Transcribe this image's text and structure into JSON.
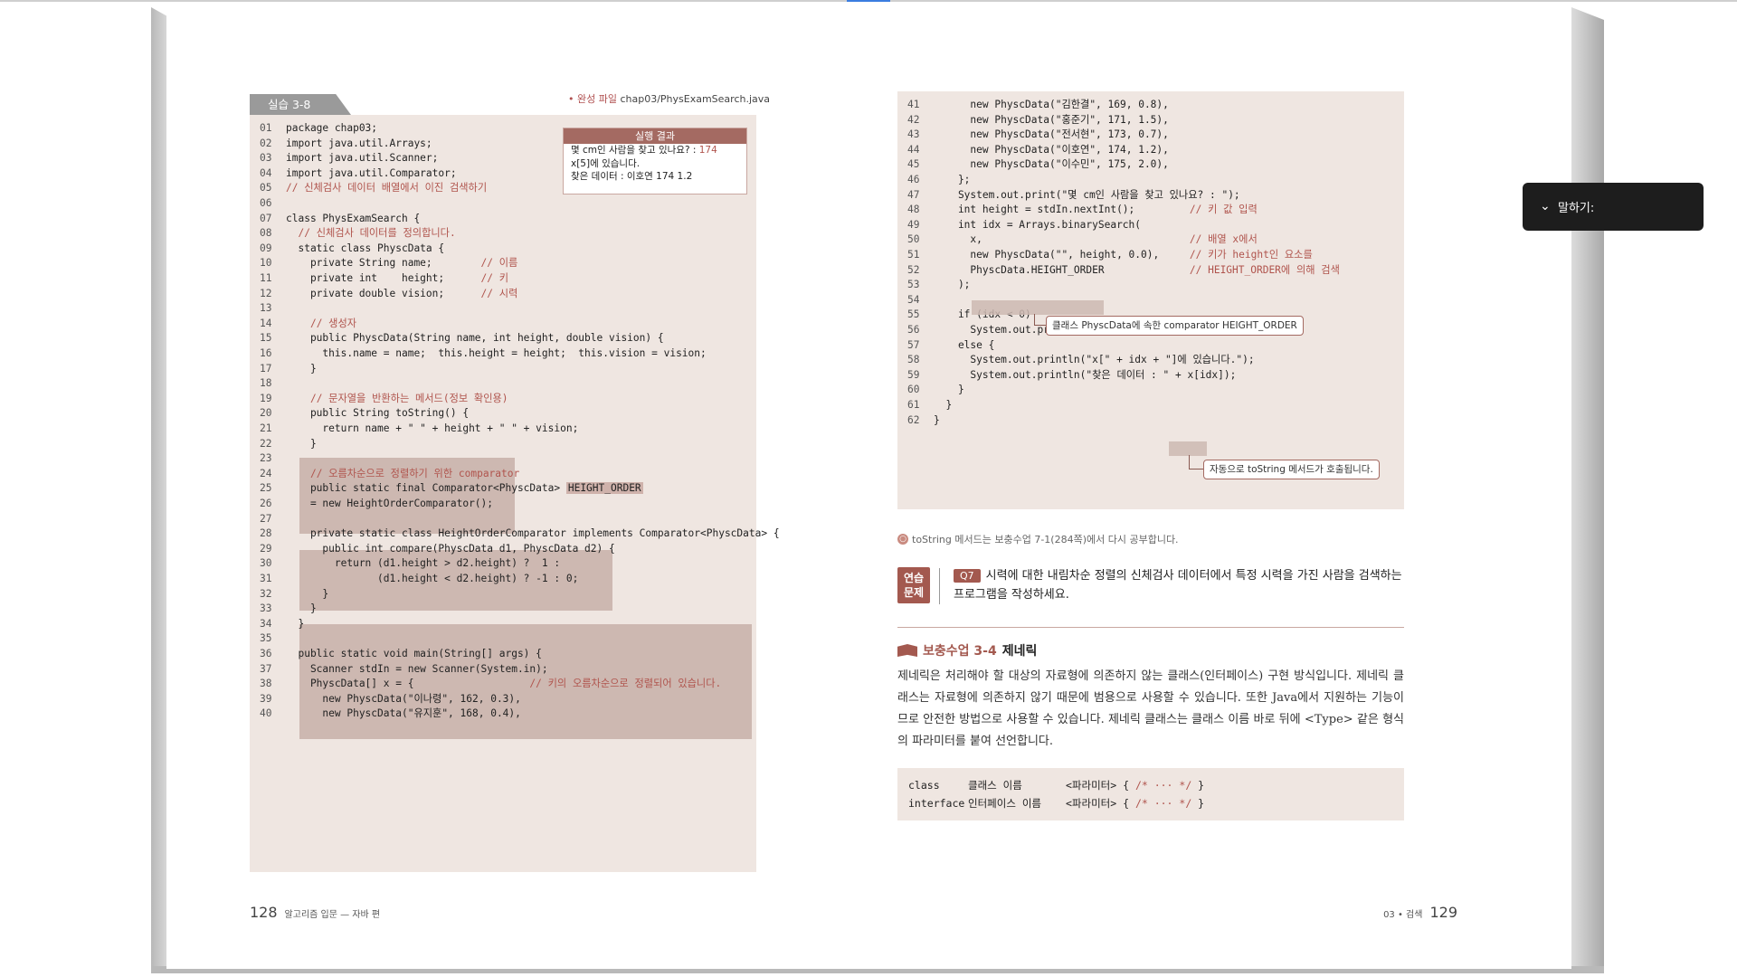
{
  "left_page": {
    "exercise_tag": "실습 3-8",
    "file_label_prefix": "• 완성 파일",
    "file_label_path": "chap03/PhysExamSearch.java",
    "result_box": {
      "title": "실행 결과",
      "lines": [
        "몇 cm인 사람을 찾고 있나요? : ",
        "x[5]에 있습니다.",
        "찾은 데이터 : 이호연 174 1.2"
      ],
      "input_value": "174"
    },
    "code_lines": [
      {
        "n": "01",
        "code": "package chap03;",
        "comment": ""
      },
      {
        "n": "02",
        "code": "import java.util.Arrays;",
        "comment": ""
      },
      {
        "n": "03",
        "code": "import java.util.Scanner;",
        "comment": ""
      },
      {
        "n": "04",
        "code": "import java.util.Comparator;",
        "comment": ""
      },
      {
        "n": "05",
        "code": "",
        "comment": "// 신체검사 데이터 배열에서 이진 검색하기"
      },
      {
        "n": "06",
        "code": "",
        "comment": ""
      },
      {
        "n": "07",
        "code": "class PhysExamSearch {",
        "comment": ""
      },
      {
        "n": "08",
        "code": "  ",
        "comment": "// 신체검사 데이터를 정의합니다."
      },
      {
        "n": "09",
        "code": "  static class PhyscData {",
        "comment": ""
      },
      {
        "n": "10",
        "code": "    private String name;        ",
        "comment": "// 이름"
      },
      {
        "n": "11",
        "code": "    private int    height;      ",
        "comment": "// 키"
      },
      {
        "n": "12",
        "code": "    private double vision;      ",
        "comment": "// 시력"
      },
      {
        "n": "13",
        "code": "",
        "comment": ""
      },
      {
        "n": "14",
        "code": "    ",
        "comment": "// 생성자"
      },
      {
        "n": "15",
        "code": "    public PhyscData(String name, int height, double vision) {",
        "comment": ""
      },
      {
        "n": "16",
        "code": "      this.name = name;  this.height = height;  this.vision = vision;",
        "comment": ""
      },
      {
        "n": "17",
        "code": "    }",
        "comment": ""
      },
      {
        "n": "18",
        "code": "",
        "comment": ""
      },
      {
        "n": "19",
        "code": "    ",
        "comment": "// 문자열을 반환하는 메서드(정보 확인용)"
      },
      {
        "n": "20",
        "code": "    public String toString() {",
        "comment": ""
      },
      {
        "n": "21",
        "code": "      return name + \" \" + height + \" \" + vision;",
        "comment": ""
      },
      {
        "n": "22",
        "code": "    }",
        "comment": ""
      },
      {
        "n": "23",
        "code": "",
        "comment": ""
      },
      {
        "n": "24",
        "code": "    ",
        "comment": "// 오름차순으로 정렬하기 위한 comparator"
      },
      {
        "n": "25",
        "code": "    public static final Comparator<PhyscData> ",
        "comment": "",
        "kw": "HEIGHT_ORDER"
      },
      {
        "n": "26",
        "code": "    = new HeightOrderComparator();",
        "comment": ""
      },
      {
        "n": "27",
        "code": "",
        "comment": ""
      },
      {
        "n": "28",
        "code": "    private static class HeightOrderComparator implements Comparator<PhyscData> {",
        "comment": ""
      },
      {
        "n": "29",
        "code": "      public int compare(PhyscData d1, PhyscData d2) {",
        "comment": ""
      },
      {
        "n": "30",
        "code": "        return (d1.height > d2.height) ?  1 :",
        "comment": ""
      },
      {
        "n": "31",
        "code": "               (d1.height < d2.height) ? -1 : 0;",
        "comment": ""
      },
      {
        "n": "32",
        "code": "      }",
        "comment": ""
      },
      {
        "n": "33",
        "code": "    }",
        "comment": ""
      },
      {
        "n": "34",
        "code": "  }",
        "comment": ""
      },
      {
        "n": "35",
        "code": "",
        "comment": ""
      },
      {
        "n": "36",
        "code": "  public static void main(String[] args) {",
        "comment": ""
      },
      {
        "n": "37",
        "code": "    Scanner stdIn = new Scanner(System.in);",
        "comment": ""
      },
      {
        "n": "38",
        "code": "    PhyscData[] x = {                   ",
        "comment": "// 키의 오름차순으로 정렬되어 있습니다."
      },
      {
        "n": "39",
        "code": "      new PhyscData(\"이나령\", 162, 0.3),",
        "comment": ""
      },
      {
        "n": "40",
        "code": "      new PhyscData(\"유지훈\", 168, 0.4),",
        "comment": ""
      }
    ],
    "page_number": "128",
    "running_head": "알고리즘 입문 — 자바 편"
  },
  "right_page": {
    "code_lines": [
      {
        "n": "41",
        "code": "      new PhyscData(\"김한결\", 169, 0.8),",
        "comment": ""
      },
      {
        "n": "42",
        "code": "      new PhyscData(\"홍준기\", 171, 1.5),",
        "comment": ""
      },
      {
        "n": "43",
        "code": "      new PhyscData(\"전서현\", 173, 0.7),",
        "comment": ""
      },
      {
        "n": "44",
        "code": "      new PhyscData(\"이호연\", 174, 1.2),",
        "comment": ""
      },
      {
        "n": "45",
        "code": "      new PhyscData(\"이수민\", 175, 2.0),",
        "comment": ""
      },
      {
        "n": "46",
        "code": "    };",
        "comment": ""
      },
      {
        "n": "47",
        "code": "    System.out.print(\"몇 cm인 사람을 찾고 있나요? : \");",
        "comment": ""
      },
      {
        "n": "48",
        "code": "    int height = stdIn.nextInt();         ",
        "comment": "// 키 값 입력"
      },
      {
        "n": "49",
        "code": "    int idx = Arrays.binarySearch(",
        "comment": ""
      },
      {
        "n": "50",
        "code": "      x,                                  ",
        "comment": "// 배열 x에서"
      },
      {
        "n": "51",
        "code": "      new PhyscData(\"\", height, 0.0),     ",
        "comment": "// 키가 height인 요소를"
      },
      {
        "n": "52",
        "code": "      PhyscData.HEIGHT_ORDER              ",
        "comment": "// HEIGHT_ORDER에 의해 검색"
      },
      {
        "n": "53",
        "code": "    );",
        "comment": ""
      },
      {
        "n": "54",
        "code": "",
        "comment": ""
      },
      {
        "n": "55",
        "code": "    if (idx < 0)",
        "comment": ""
      },
      {
        "n": "56",
        "code": "      System.out.println(\"요소가 없습니다.\");",
        "comment": ""
      },
      {
        "n": "57",
        "code": "    else {",
        "comment": ""
      },
      {
        "n": "58",
        "code": "      System.out.println(\"x[\" + idx + \"]에 있습니다.\");",
        "comment": ""
      },
      {
        "n": "59",
        "code": "      System.out.println(\"찾은 데이터 : \" + x[idx]);",
        "comment": ""
      },
      {
        "n": "60",
        "code": "    }",
        "comment": ""
      },
      {
        "n": "61",
        "code": "  }",
        "comment": ""
      },
      {
        "n": "62",
        "code": "}",
        "comment": ""
      }
    ],
    "callout_1": "클래스 PhyscData에 속한 comparator HEIGHT_ORDER",
    "callout_2": "자동으로 toString 메서드가 호출됩니다.",
    "note": "toString 메서드는 보충수업 7-1(284쪽)에서 다시 공부합니다.",
    "exercise": {
      "badge_line1": "연습",
      "badge_line2": "문제",
      "q_label": "Q7",
      "text": "시력에 대한 내림차순 정렬의 신체검사 데이터에서 특정 시력을 가진 사람을 검색하는 프로그램을 작성하세요."
    },
    "section": {
      "label": "보충수업 3-4",
      "title": "제네릭"
    },
    "paragraph": "제네릭은 처리해야 할 대상의 자료형에 의존하지 않는 클래스(인터페이스) 구현 방식입니다. 제네릭 클래스는 자료형에 의존하지 않기 때문에 범용으로 사용할 수 있습니다. 또한 Java에서 지원하는 기능이므로 안전한 방법으로 사용할 수 있습니다. 제네릭 클래스는 클래스 이름 바로 뒤에 <Type> 같은 형식의 파라미터를 붙여 선언합니다.",
    "syntax": [
      {
        "kw": "class",
        "name": "클래스 이름",
        "param": "<파라미터> { ",
        "c": "/* ··· */",
        "end": " }"
      },
      {
        "kw": "interface",
        "name": "인터페이스 이름",
        "param": "<파라미터> { ",
        "c": "/* ··· */",
        "end": " }"
      }
    ],
    "page_number": "129",
    "running_head": "03 • 검색"
  },
  "speak_button": {
    "label": "말하기:"
  }
}
